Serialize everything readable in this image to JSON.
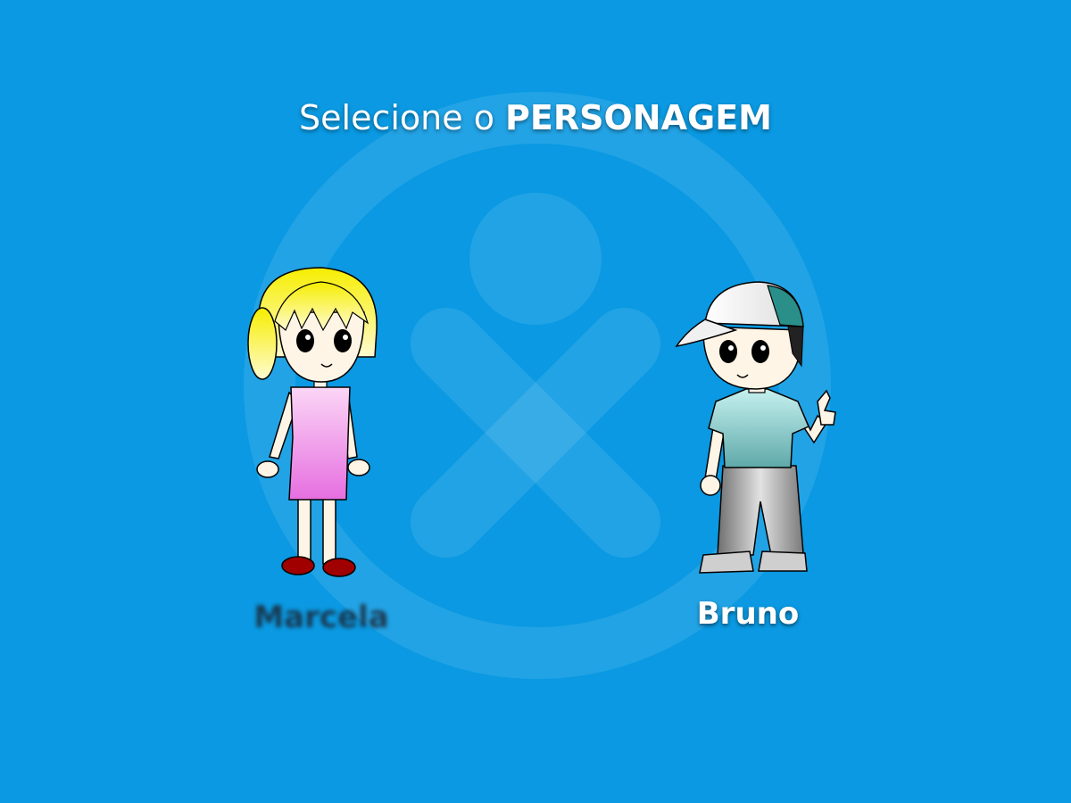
{
  "title": {
    "prefix": "Selecione o",
    "emphasis": "PERSONAGEM"
  },
  "characters": [
    {
      "name": "Marcela",
      "state": "unselected"
    },
    {
      "name": "Bruno",
      "state": "selected"
    }
  ],
  "background": {
    "icon": "person-circle-logo-icon"
  },
  "colors": {
    "background": "#0a99e2",
    "logo_tint": "#ffffff",
    "title": "#ffffff",
    "selected_name": "#ffffff",
    "unselected_name": "#1b2a3a"
  }
}
